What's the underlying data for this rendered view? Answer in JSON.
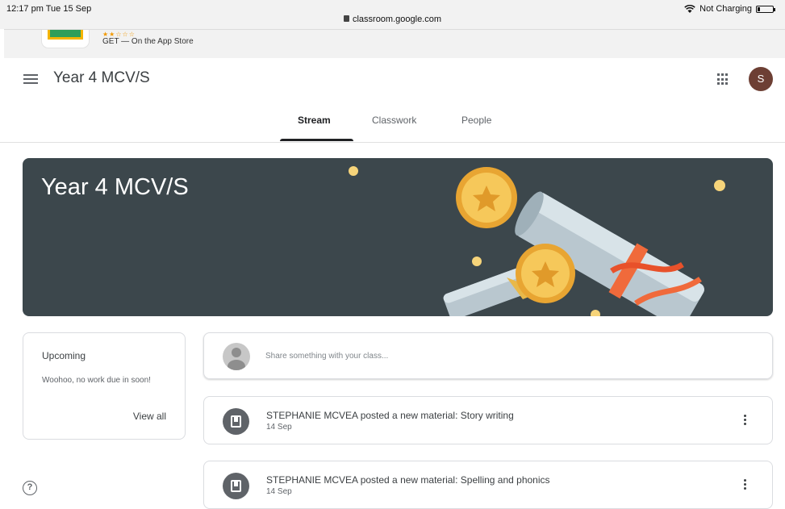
{
  "status_bar": {
    "time": "12:17 pm  Tue 15 Sep",
    "url": "classroom.google.com",
    "charging": "Not Charging"
  },
  "app_banner": {
    "stars": "★★☆☆☆",
    "get_label": "GET — On the App Store"
  },
  "header": {
    "class_name": "Year 4 MCV/S",
    "avatar_initial": "S"
  },
  "tabs": [
    {
      "label": "Stream",
      "active": true
    },
    {
      "label": "Classwork",
      "active": false
    },
    {
      "label": "People",
      "active": false
    }
  ],
  "banner": {
    "title": "Year 4 MCV/S",
    "background": "#3c474c"
  },
  "upcoming": {
    "title": "Upcoming",
    "message": "Woohoo, no work due in soon!",
    "view_all": "View all"
  },
  "share": {
    "placeholder": "Share something with your class..."
  },
  "posts": [
    {
      "title": "STEPHANIE MCVEA posted a new material: Story writing",
      "date": "14 Sep"
    },
    {
      "title": "STEPHANIE MCVEA posted a new material: Spelling and phonics",
      "date": "14 Sep"
    }
  ],
  "help": {
    "symbol": "?"
  }
}
